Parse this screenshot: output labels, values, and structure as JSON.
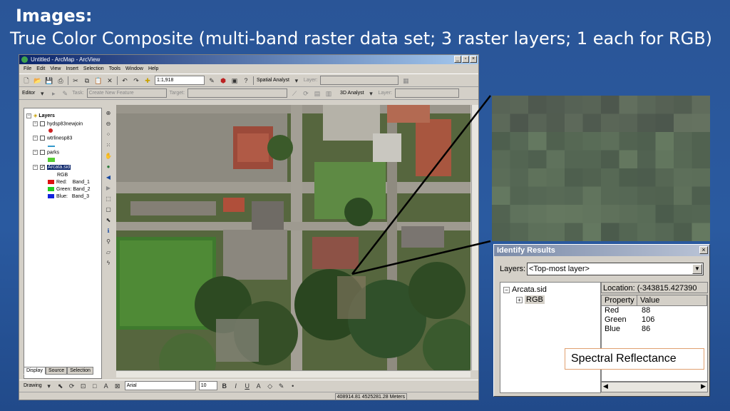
{
  "slide": {
    "title": "Images:",
    "subtitle": "True Color Composite (multi-band raster data set; 3 raster layers; 1 each for RGB)"
  },
  "arcmap": {
    "window_title": "Untitled - ArcMap - ArcView",
    "menu": [
      "File",
      "Edit",
      "View",
      "Insert",
      "Selection",
      "Tools",
      "Window",
      "Help"
    ],
    "scale": "1:1,918",
    "spatial_analyst": "Spatial Analyst",
    "layer_label": "Layer:",
    "editor": "Editor",
    "task_label": "Task:",
    "task_value": "Create New Feature",
    "target_label": "Target:",
    "analyst_3d": "3D Analyst",
    "toc": {
      "root": "Layers",
      "layers": [
        {
          "name": "hydsp83newjoin",
          "checked": false,
          "symbol_color": "#cc2222"
        },
        {
          "name": "wtrlinesp83",
          "checked": false,
          "symbol_color": "#3399cc"
        },
        {
          "name": "parks",
          "checked": false,
          "symbol_color": "#55cc33"
        },
        {
          "name": "Arcata.sid",
          "checked": true,
          "selected": true
        }
      ],
      "rgb_label": "RGB",
      "bands": [
        {
          "label": "Red:",
          "band": "Band_1",
          "color": "#dd1111"
        },
        {
          "label": "Green:",
          "band": "Band_2",
          "color": "#22cc22"
        },
        {
          "label": "Blue:",
          "band": "Band_3",
          "color": "#1122dd"
        }
      ],
      "tabs": [
        "Display",
        "Source",
        "Selection"
      ]
    },
    "drawing": "Drawing",
    "font_name": "Arial",
    "font_size": "10",
    "coords": "408914.81  4525281.28 Meters"
  },
  "identify": {
    "title": "Identify Results",
    "layers_label": "Layers:",
    "layers_value": "<Top-most layer>",
    "tree_root": "Arcata.sid",
    "tree_child": "RGB",
    "location": "Location: (-343815.427390",
    "headers": [
      "Property",
      "Value"
    ],
    "rows": [
      {
        "property": "Red",
        "value": "88"
      },
      {
        "property": "Green",
        "value": "106"
      },
      {
        "property": "Blue",
        "value": "86"
      }
    ]
  },
  "callout": "Spectral Reflectance",
  "colors": {
    "background": "#2a5597",
    "identify_title": "#7b8ba8",
    "callout_border": "#e0a070"
  }
}
